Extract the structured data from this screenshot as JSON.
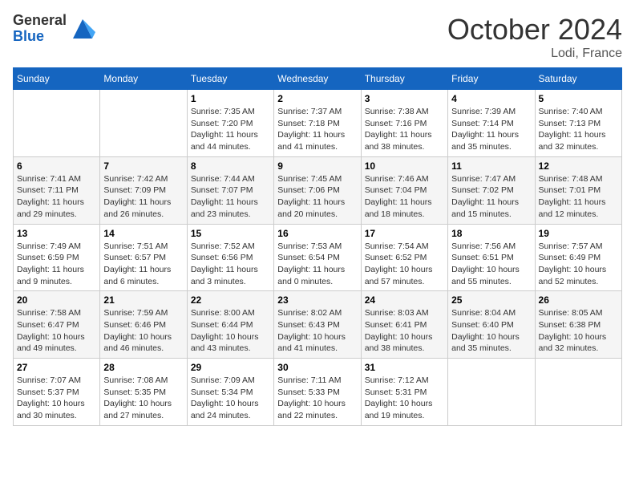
{
  "logo": {
    "general": "General",
    "blue": "Blue"
  },
  "title": "October 2024",
  "location": "Lodi, France",
  "days_of_week": [
    "Sunday",
    "Monday",
    "Tuesday",
    "Wednesday",
    "Thursday",
    "Friday",
    "Saturday"
  ],
  "weeks": [
    [
      {
        "day": "",
        "info": ""
      },
      {
        "day": "",
        "info": ""
      },
      {
        "day": "1",
        "sunrise": "Sunrise: 7:35 AM",
        "sunset": "Sunset: 7:20 PM",
        "daylight": "Daylight: 11 hours and 44 minutes."
      },
      {
        "day": "2",
        "sunrise": "Sunrise: 7:37 AM",
        "sunset": "Sunset: 7:18 PM",
        "daylight": "Daylight: 11 hours and 41 minutes."
      },
      {
        "day": "3",
        "sunrise": "Sunrise: 7:38 AM",
        "sunset": "Sunset: 7:16 PM",
        "daylight": "Daylight: 11 hours and 38 minutes."
      },
      {
        "day": "4",
        "sunrise": "Sunrise: 7:39 AM",
        "sunset": "Sunset: 7:14 PM",
        "daylight": "Daylight: 11 hours and 35 minutes."
      },
      {
        "day": "5",
        "sunrise": "Sunrise: 7:40 AM",
        "sunset": "Sunset: 7:13 PM",
        "daylight": "Daylight: 11 hours and 32 minutes."
      }
    ],
    [
      {
        "day": "6",
        "sunrise": "Sunrise: 7:41 AM",
        "sunset": "Sunset: 7:11 PM",
        "daylight": "Daylight: 11 hours and 29 minutes."
      },
      {
        "day": "7",
        "sunrise": "Sunrise: 7:42 AM",
        "sunset": "Sunset: 7:09 PM",
        "daylight": "Daylight: 11 hours and 26 minutes."
      },
      {
        "day": "8",
        "sunrise": "Sunrise: 7:44 AM",
        "sunset": "Sunset: 7:07 PM",
        "daylight": "Daylight: 11 hours and 23 minutes."
      },
      {
        "day": "9",
        "sunrise": "Sunrise: 7:45 AM",
        "sunset": "Sunset: 7:06 PM",
        "daylight": "Daylight: 11 hours and 20 minutes."
      },
      {
        "day": "10",
        "sunrise": "Sunrise: 7:46 AM",
        "sunset": "Sunset: 7:04 PM",
        "daylight": "Daylight: 11 hours and 18 minutes."
      },
      {
        "day": "11",
        "sunrise": "Sunrise: 7:47 AM",
        "sunset": "Sunset: 7:02 PM",
        "daylight": "Daylight: 11 hours and 15 minutes."
      },
      {
        "day": "12",
        "sunrise": "Sunrise: 7:48 AM",
        "sunset": "Sunset: 7:01 PM",
        "daylight": "Daylight: 11 hours and 12 minutes."
      }
    ],
    [
      {
        "day": "13",
        "sunrise": "Sunrise: 7:49 AM",
        "sunset": "Sunset: 6:59 PM",
        "daylight": "Daylight: 11 hours and 9 minutes."
      },
      {
        "day": "14",
        "sunrise": "Sunrise: 7:51 AM",
        "sunset": "Sunset: 6:57 PM",
        "daylight": "Daylight: 11 hours and 6 minutes."
      },
      {
        "day": "15",
        "sunrise": "Sunrise: 7:52 AM",
        "sunset": "Sunset: 6:56 PM",
        "daylight": "Daylight: 11 hours and 3 minutes."
      },
      {
        "day": "16",
        "sunrise": "Sunrise: 7:53 AM",
        "sunset": "Sunset: 6:54 PM",
        "daylight": "Daylight: 11 hours and 0 minutes."
      },
      {
        "day": "17",
        "sunrise": "Sunrise: 7:54 AM",
        "sunset": "Sunset: 6:52 PM",
        "daylight": "Daylight: 10 hours and 57 minutes."
      },
      {
        "day": "18",
        "sunrise": "Sunrise: 7:56 AM",
        "sunset": "Sunset: 6:51 PM",
        "daylight": "Daylight: 10 hours and 55 minutes."
      },
      {
        "day": "19",
        "sunrise": "Sunrise: 7:57 AM",
        "sunset": "Sunset: 6:49 PM",
        "daylight": "Daylight: 10 hours and 52 minutes."
      }
    ],
    [
      {
        "day": "20",
        "sunrise": "Sunrise: 7:58 AM",
        "sunset": "Sunset: 6:47 PM",
        "daylight": "Daylight: 10 hours and 49 minutes."
      },
      {
        "day": "21",
        "sunrise": "Sunrise: 7:59 AM",
        "sunset": "Sunset: 6:46 PM",
        "daylight": "Daylight: 10 hours and 46 minutes."
      },
      {
        "day": "22",
        "sunrise": "Sunrise: 8:00 AM",
        "sunset": "Sunset: 6:44 PM",
        "daylight": "Daylight: 10 hours and 43 minutes."
      },
      {
        "day": "23",
        "sunrise": "Sunrise: 8:02 AM",
        "sunset": "Sunset: 6:43 PM",
        "daylight": "Daylight: 10 hours and 41 minutes."
      },
      {
        "day": "24",
        "sunrise": "Sunrise: 8:03 AM",
        "sunset": "Sunset: 6:41 PM",
        "daylight": "Daylight: 10 hours and 38 minutes."
      },
      {
        "day": "25",
        "sunrise": "Sunrise: 8:04 AM",
        "sunset": "Sunset: 6:40 PM",
        "daylight": "Daylight: 10 hours and 35 minutes."
      },
      {
        "day": "26",
        "sunrise": "Sunrise: 8:05 AM",
        "sunset": "Sunset: 6:38 PM",
        "daylight": "Daylight: 10 hours and 32 minutes."
      }
    ],
    [
      {
        "day": "27",
        "sunrise": "Sunrise: 7:07 AM",
        "sunset": "Sunset: 5:37 PM",
        "daylight": "Daylight: 10 hours and 30 minutes."
      },
      {
        "day": "28",
        "sunrise": "Sunrise: 7:08 AM",
        "sunset": "Sunset: 5:35 PM",
        "daylight": "Daylight: 10 hours and 27 minutes."
      },
      {
        "day": "29",
        "sunrise": "Sunrise: 7:09 AM",
        "sunset": "Sunset: 5:34 PM",
        "daylight": "Daylight: 10 hours and 24 minutes."
      },
      {
        "day": "30",
        "sunrise": "Sunrise: 7:11 AM",
        "sunset": "Sunset: 5:33 PM",
        "daylight": "Daylight: 10 hours and 22 minutes."
      },
      {
        "day": "31",
        "sunrise": "Sunrise: 7:12 AM",
        "sunset": "Sunset: 5:31 PM",
        "daylight": "Daylight: 10 hours and 19 minutes."
      },
      {
        "day": "",
        "info": ""
      },
      {
        "day": "",
        "info": ""
      }
    ]
  ]
}
